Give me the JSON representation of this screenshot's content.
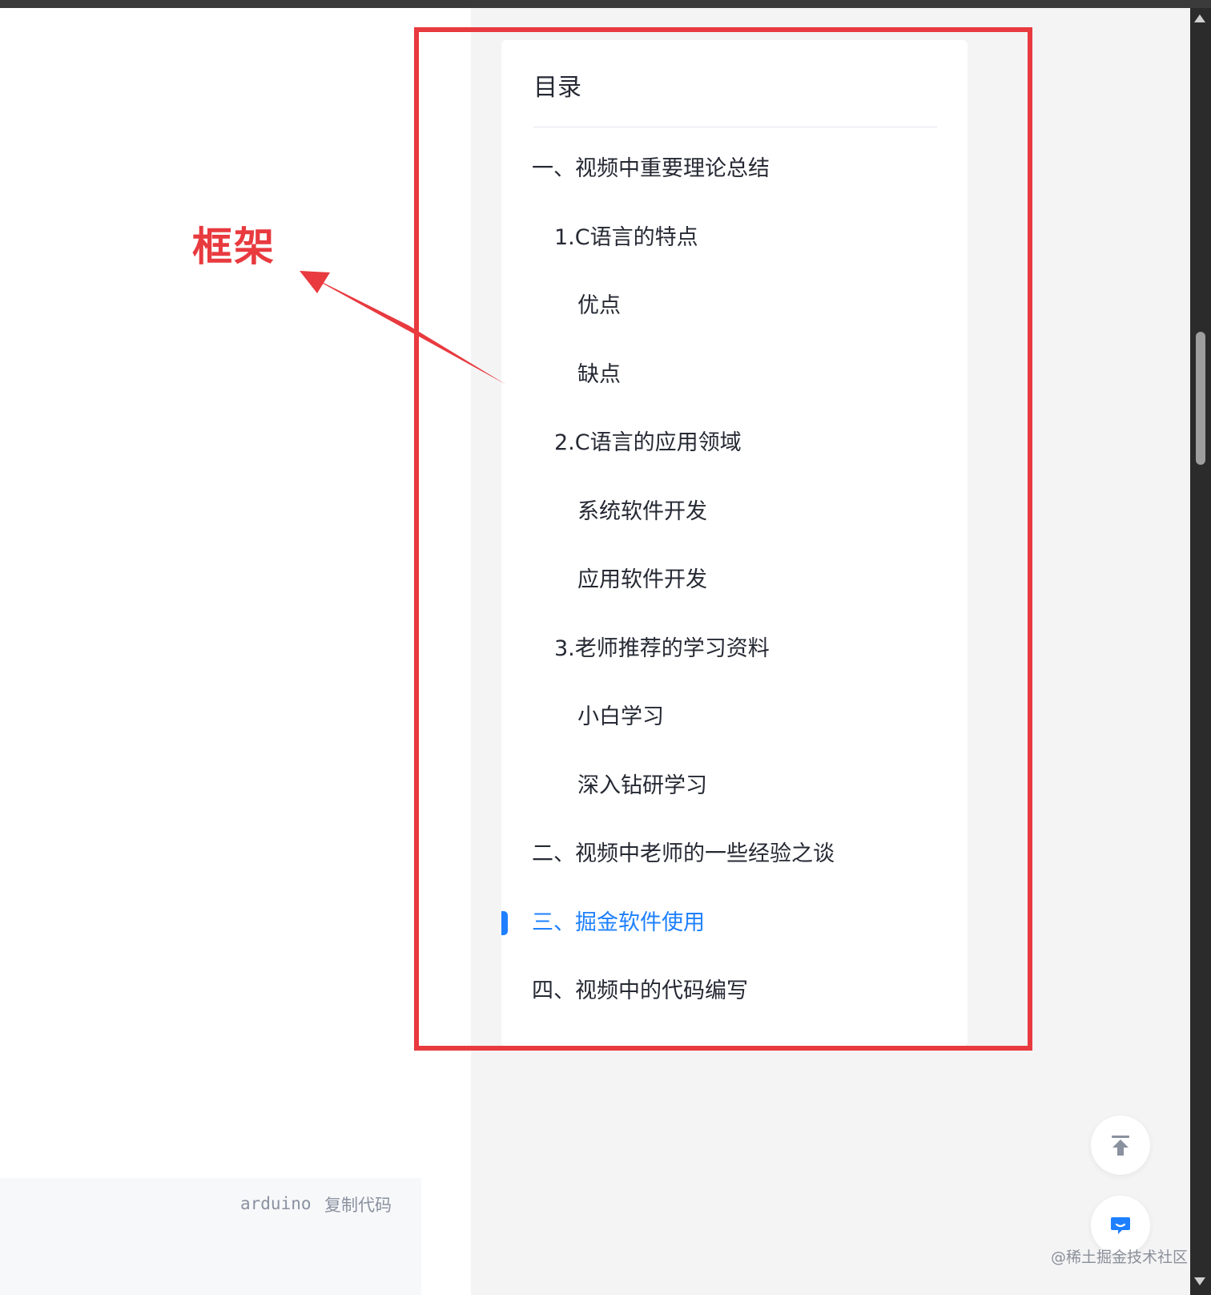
{
  "code_block": {
    "language": "arduino",
    "copy_label": "复制代码"
  },
  "toc": {
    "title": "目录",
    "items": [
      {
        "label": "一、视频中重要理论总结",
        "level": 1,
        "active": false
      },
      {
        "label": "1.C语言的特点",
        "level": 2,
        "active": false
      },
      {
        "label": "优点",
        "level": 3,
        "active": false
      },
      {
        "label": "缺点",
        "level": 3,
        "active": false
      },
      {
        "label": "2.C语言的应用领域",
        "level": 2,
        "active": false
      },
      {
        "label": "系统软件开发",
        "level": 3,
        "active": false
      },
      {
        "label": "应用软件开发",
        "level": 3,
        "active": false
      },
      {
        "label": "3.老师推荐的学习资料",
        "level": 2,
        "active": false
      },
      {
        "label": "小白学习",
        "level": 3,
        "active": false
      },
      {
        "label": "深入钻研学习",
        "level": 3,
        "active": false
      },
      {
        "label": "二、视频中老师的一些经验之谈",
        "level": 1,
        "active": false
      },
      {
        "label": "三、掘金软件使用",
        "level": 1,
        "active": true
      },
      {
        "label": "四、视频中的代码编写",
        "level": 1,
        "active": false
      }
    ]
  },
  "annotation": {
    "label": "框架",
    "color": "#e83a3f"
  },
  "icons": {
    "back_to_top": "arrow-up-to-line-icon",
    "chat": "chat-bubble-icon"
  },
  "watermark": "@稀土掘金技术社区",
  "colors": {
    "accent": "#1e80ff",
    "annotation": "#e83a3f",
    "text": "#252933"
  }
}
